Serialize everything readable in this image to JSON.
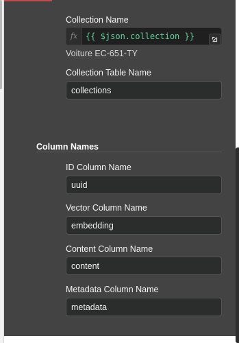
{
  "collection": {
    "name_label": "Collection Name",
    "expression_badge": "fx",
    "expression_value": "{{ $json.collection }}",
    "resolved_value": "Voiture EC-651-TY",
    "table_label": "Collection Table Name",
    "table_value": "collections"
  },
  "column_names": {
    "title": "Column Names",
    "id_label": "ID Column Name",
    "id_value": "uuid",
    "vector_label": "Vector Column Name",
    "vector_value": "embedding",
    "content_label": "Content Column Name",
    "content_value": "content",
    "metadata_label": "Metadata Column Name",
    "metadata_value": "metadata"
  },
  "colors": {
    "panel_bg": "#434343",
    "field_bg": "#2b2c2c",
    "expression_text": "#5fd49a",
    "accent": "#c64b4b"
  },
  "icons": {
    "expression": "fx-icon",
    "expand": "open-in-editor-icon"
  }
}
